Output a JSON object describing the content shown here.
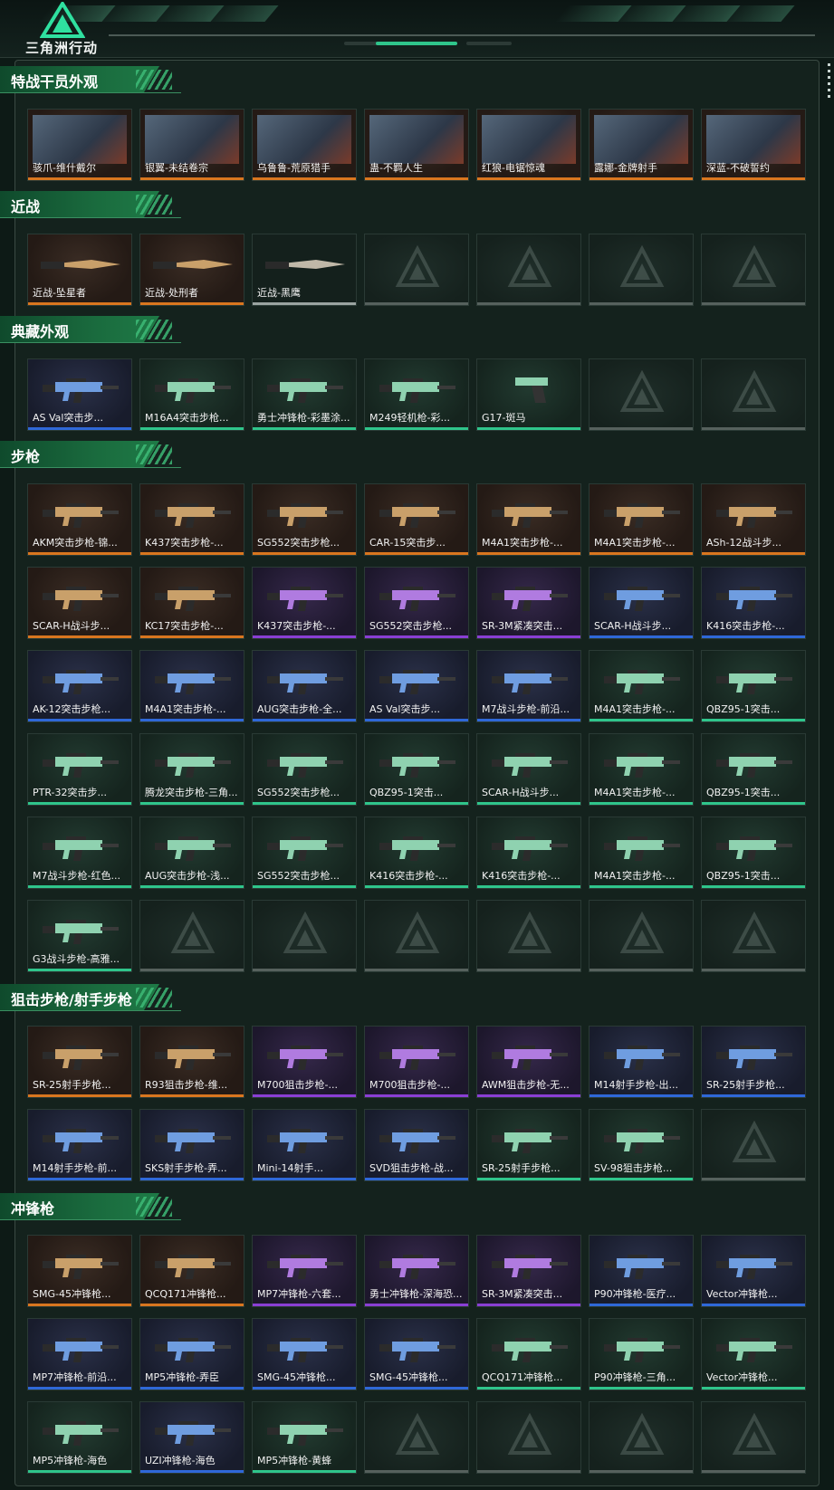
{
  "header": {
    "logo_text": "三角洲行动",
    "logo_icon": "delta-triangle-logo-icon"
  },
  "colors": {
    "orange": "#d9761f",
    "blue": "#2f68d8",
    "purple": "#8a3fd4",
    "green": "#2fc58b",
    "gray": "#56615d"
  },
  "sections": [
    {
      "title": "特战干员外观",
      "items": [
        {
          "name": "骇爪-维什戴尔",
          "rarity": "orange",
          "kind": "portrait"
        },
        {
          "name": "银翼-未结卷宗",
          "rarity": "orange",
          "kind": "portrait"
        },
        {
          "name": "乌鲁鲁-荒原猎手",
          "rarity": "orange",
          "kind": "portrait"
        },
        {
          "name": "蛊-不羁人生",
          "rarity": "orange",
          "kind": "portrait"
        },
        {
          "name": "红狼-电锯惊魂",
          "rarity": "orange",
          "kind": "portrait"
        },
        {
          "name": "露娜-金牌射手",
          "rarity": "orange",
          "kind": "portrait"
        },
        {
          "name": "深蓝-不破誓约",
          "rarity": "orange",
          "kind": "portrait"
        }
      ]
    },
    {
      "title": "近战",
      "items": [
        {
          "name": "近战-坠星者",
          "rarity": "orange",
          "kind": "knife"
        },
        {
          "name": "近战-处刑者",
          "rarity": "orange",
          "kind": "knife"
        },
        {
          "name": "近战-黑鹰",
          "rarity": "gray",
          "kind": "knife"
        },
        {
          "empty": true
        },
        {
          "empty": true
        },
        {
          "empty": true
        },
        {
          "empty": true
        }
      ]
    },
    {
      "title": "典藏外观",
      "items": [
        {
          "name": "AS Val突击步...",
          "rarity": "blue",
          "kind": "gun"
        },
        {
          "name": "M16A4突击步枪...",
          "rarity": "green",
          "kind": "gun"
        },
        {
          "name": "勇士冲锋枪-彩墨涂...",
          "rarity": "green",
          "kind": "gun"
        },
        {
          "name": "M249轻机枪-彩...",
          "rarity": "green",
          "kind": "gun"
        },
        {
          "name": "G17-斑马",
          "rarity": "green",
          "kind": "pistol"
        },
        {
          "empty": true
        },
        {
          "empty": true
        }
      ]
    },
    {
      "title": "步枪",
      "items": [
        {
          "name": "AKM突击步枪-锦...",
          "rarity": "orange",
          "kind": "gun"
        },
        {
          "name": "K437突击步枪-...",
          "rarity": "orange",
          "kind": "gun"
        },
        {
          "name": "SG552突击步枪...",
          "rarity": "orange",
          "kind": "gun"
        },
        {
          "name": "CAR-15突击步...",
          "rarity": "orange",
          "kind": "gun"
        },
        {
          "name": "M4A1突击步枪-...",
          "rarity": "orange",
          "kind": "gun"
        },
        {
          "name": "M4A1突击步枪-...",
          "rarity": "orange",
          "kind": "gun"
        },
        {
          "name": "ASh-12战斗步...",
          "rarity": "orange",
          "kind": "gun"
        },
        {
          "name": "SCAR-H战斗步...",
          "rarity": "orange",
          "kind": "gun"
        },
        {
          "name": "KC17突击步枪-...",
          "rarity": "orange",
          "kind": "gun"
        },
        {
          "name": "K437突击步枪-...",
          "rarity": "purple",
          "kind": "gun"
        },
        {
          "name": "SG552突击步枪...",
          "rarity": "purple",
          "kind": "gun"
        },
        {
          "name": "SR-3M紧凑突击...",
          "rarity": "purple",
          "kind": "gun"
        },
        {
          "name": "SCAR-H战斗步...",
          "rarity": "blue",
          "kind": "gun"
        },
        {
          "name": "K416突击步枪-...",
          "rarity": "blue",
          "kind": "gun"
        },
        {
          "name": "AK-12突击步枪...",
          "rarity": "blue",
          "kind": "gun"
        },
        {
          "name": "M4A1突击步枪-...",
          "rarity": "blue",
          "kind": "gun"
        },
        {
          "name": "AUG突击步枪-全...",
          "rarity": "blue",
          "kind": "gun"
        },
        {
          "name": "AS Val突击步...",
          "rarity": "blue",
          "kind": "gun"
        },
        {
          "name": "M7战斗步枪-前沿...",
          "rarity": "blue",
          "kind": "gun"
        },
        {
          "name": "M4A1突击步枪-...",
          "rarity": "green",
          "kind": "gun"
        },
        {
          "name": "QBZ95-1突击...",
          "rarity": "green",
          "kind": "gun"
        },
        {
          "name": "PTR-32突击步...",
          "rarity": "green",
          "kind": "gun"
        },
        {
          "name": "腾龙突击步枪-三角...",
          "rarity": "green",
          "kind": "gun"
        },
        {
          "name": "SG552突击步枪...",
          "rarity": "green",
          "kind": "gun"
        },
        {
          "name": "QBZ95-1突击...",
          "rarity": "green",
          "kind": "gun"
        },
        {
          "name": "SCAR-H战斗步...",
          "rarity": "green",
          "kind": "gun"
        },
        {
          "name": "M4A1突击步枪-...",
          "rarity": "green",
          "kind": "gun"
        },
        {
          "name": "QBZ95-1突击...",
          "rarity": "green",
          "kind": "gun"
        },
        {
          "name": "M7战斗步枪-红色...",
          "rarity": "green",
          "kind": "gun"
        },
        {
          "name": "AUG突击步枪-浅...",
          "rarity": "green",
          "kind": "gun"
        },
        {
          "name": "SG552突击步枪...",
          "rarity": "green",
          "kind": "gun"
        },
        {
          "name": "K416突击步枪-...",
          "rarity": "green",
          "kind": "gun"
        },
        {
          "name": "K416突击步枪-...",
          "rarity": "green",
          "kind": "gun"
        },
        {
          "name": "M4A1突击步枪-...",
          "rarity": "green",
          "kind": "gun"
        },
        {
          "name": "QBZ95-1突击...",
          "rarity": "green",
          "kind": "gun"
        },
        {
          "name": "G3战斗步枪-高雅...",
          "rarity": "green",
          "kind": "gun"
        },
        {
          "empty": true
        },
        {
          "empty": true
        },
        {
          "empty": true
        },
        {
          "empty": true
        },
        {
          "empty": true
        },
        {
          "empty": true
        }
      ]
    },
    {
      "title": "狙击步枪/射手步枪",
      "items": [
        {
          "name": "SR-25射手步枪...",
          "rarity": "orange",
          "kind": "gun"
        },
        {
          "name": "R93狙击步枪-维...",
          "rarity": "orange",
          "kind": "gun"
        },
        {
          "name": "M700狙击步枪-...",
          "rarity": "purple",
          "kind": "gun"
        },
        {
          "name": "M700狙击步枪-...",
          "rarity": "purple",
          "kind": "gun"
        },
        {
          "name": "AWM狙击步枪-无...",
          "rarity": "purple",
          "kind": "gun"
        },
        {
          "name": "M14射手步枪-出...",
          "rarity": "blue",
          "kind": "gun"
        },
        {
          "name": "SR-25射手步枪...",
          "rarity": "blue",
          "kind": "gun"
        },
        {
          "name": "M14射手步枪-前...",
          "rarity": "blue",
          "kind": "gun"
        },
        {
          "name": "SKS射手步枪-弄...",
          "rarity": "blue",
          "kind": "gun"
        },
        {
          "name": "Mini-14射手...",
          "rarity": "blue",
          "kind": "gun"
        },
        {
          "name": "SVD狙击步枪-战...",
          "rarity": "blue",
          "kind": "gun"
        },
        {
          "name": "SR-25射手步枪...",
          "rarity": "green",
          "kind": "gun"
        },
        {
          "name": "SV-98狙击步枪...",
          "rarity": "green",
          "kind": "gun"
        },
        {
          "empty": true
        }
      ]
    },
    {
      "title": "冲锋枪",
      "items": [
        {
          "name": "SMG-45冲锋枪...",
          "rarity": "orange",
          "kind": "gun"
        },
        {
          "name": "QCQ171冲锋枪...",
          "rarity": "orange",
          "kind": "gun"
        },
        {
          "name": "MP7冲锋枪-六套...",
          "rarity": "purple",
          "kind": "gun"
        },
        {
          "name": "勇士冲锋枪-深海恐...",
          "rarity": "purple",
          "kind": "gun"
        },
        {
          "name": "SR-3M紧凑突击...",
          "rarity": "purple",
          "kind": "gun"
        },
        {
          "name": "P90冲锋枪-医疗...",
          "rarity": "blue",
          "kind": "gun"
        },
        {
          "name": "Vector冲锋枪...",
          "rarity": "blue",
          "kind": "gun"
        },
        {
          "name": "MP7冲锋枪-前沿...",
          "rarity": "blue",
          "kind": "gun"
        },
        {
          "name": "MP5冲锋枪-弄臣",
          "rarity": "blue",
          "kind": "gun"
        },
        {
          "name": "SMG-45冲锋枪...",
          "rarity": "blue",
          "kind": "gun"
        },
        {
          "name": "SMG-45冲锋枪...",
          "rarity": "blue",
          "kind": "gun"
        },
        {
          "name": "QCQ171冲锋枪...",
          "rarity": "green",
          "kind": "gun"
        },
        {
          "name": "P90冲锋枪-三角...",
          "rarity": "green",
          "kind": "gun"
        },
        {
          "name": "Vector冲锋枪...",
          "rarity": "green",
          "kind": "gun"
        },
        {
          "name": "MP5冲锋枪-海色",
          "rarity": "green",
          "kind": "gun"
        },
        {
          "name": "UZI冲锋枪-海色",
          "rarity": "blue",
          "kind": "gun"
        },
        {
          "name": "MP5冲锋枪-黄蜂",
          "rarity": "green",
          "kind": "gun"
        },
        {
          "empty": true
        },
        {
          "empty": true
        },
        {
          "empty": true
        },
        {
          "empty": true
        }
      ]
    }
  ]
}
